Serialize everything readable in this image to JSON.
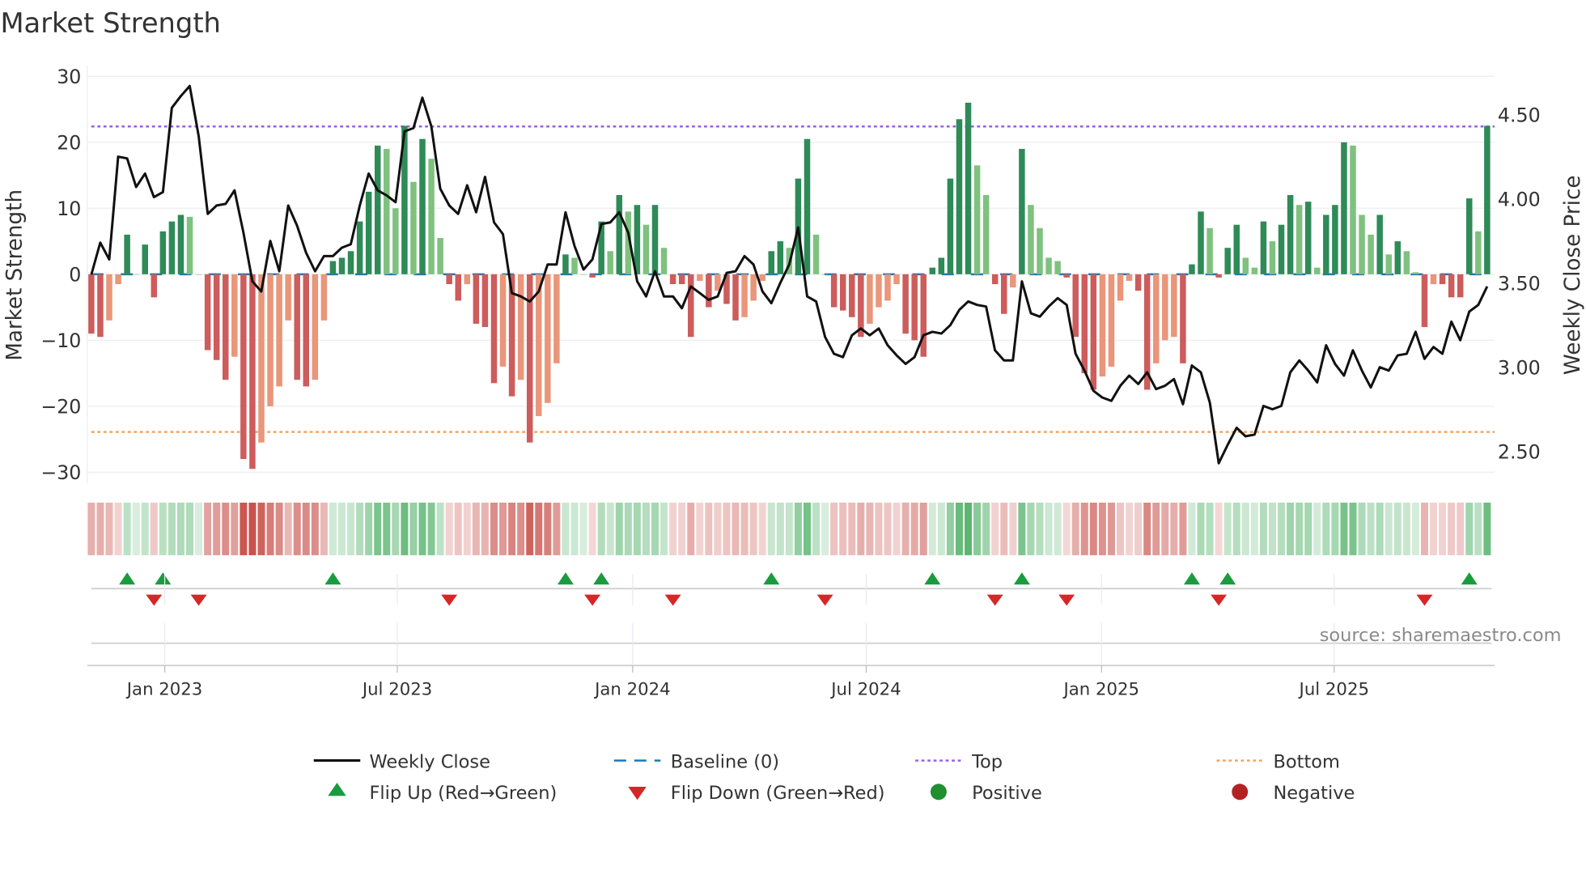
{
  "chart_data": {
    "type": "bar",
    "title": "Market Strength",
    "ylabel": "Market Strength",
    "y2label": "Weekly Close Price",
    "ylim": [
      -31.7,
      31.6
    ],
    "y2lim": [
      2.31,
      4.79
    ],
    "yticks": [
      30,
      20,
      10,
      0,
      -10,
      -20,
      -30
    ],
    "ytick_labels": [
      "30",
      "20",
      "10",
      "0",
      "−10",
      "−20",
      "−30"
    ],
    "y2ticks": [
      4.5,
      4.0,
      3.5,
      3.0,
      2.5
    ],
    "y2tick_labels": [
      "4.50",
      "4.00",
      "3.50",
      "3.00",
      "2.50"
    ],
    "xticks": [
      {
        "week": 8.2,
        "label": "Jan 2023"
      },
      {
        "week": 34.2,
        "label": "Jul 2023"
      },
      {
        "week": 60.5,
        "label": "Jan 2024"
      },
      {
        "week": 86.6,
        "label": "Jul 2024"
      },
      {
        "week": 112.9,
        "label": "Jan 2025"
      },
      {
        "week": 138.9,
        "label": "Jul 2025"
      }
    ],
    "top_level": 22.4,
    "bottom_level": -23.9,
    "strength": [
      -9,
      -9.5,
      -7,
      -1.5,
      6,
      0,
      4.5,
      -3.5,
      6.5,
      8,
      9,
      8.7,
      0,
      -11.5,
      -13,
      -16,
      -12.5,
      -28,
      -29.5,
      -25.5,
      -20,
      -17,
      -7,
      -16,
      -17,
      -16,
      -7,
      2,
      2.5,
      3.5,
      8,
      12.5,
      19.5,
      19,
      10,
      22.5,
      14,
      20.5,
      17.5,
      5.5,
      -1.5,
      -4,
      -1.5,
      -7.5,
      -8,
      -16.5,
      -14,
      -18.5,
      -16,
      -25.5,
      -21.5,
      -19.5,
      -13.5,
      3,
      2.5,
      0,
      -0.5,
      8,
      3.5,
      12,
      9.5,
      10.5,
      7.5,
      10.5,
      4,
      -1.5,
      -1.5,
      -9.5,
      -1,
      -5,
      -2.5,
      -4.5,
      -7,
      -6.5,
      -4,
      -1,
      3.5,
      5,
      4,
      14.5,
      20.5,
      6,
      0,
      -5,
      -5.5,
      -6.5,
      -9.5,
      -7.5,
      -5,
      -4,
      -1.5,
      -9,
      -10,
      -12.5,
      1,
      2.5,
      14.5,
      23.5,
      26,
      16.5,
      12,
      -1.5,
      -6,
      -2,
      19,
      10.5,
      7,
      2.5,
      2,
      -0.5,
      -9.5,
      -15,
      -17.5,
      -15.5,
      -14,
      -4,
      -1,
      -2.5,
      -17.5,
      -13.5,
      -10,
      -9.5,
      -13.5,
      1.5,
      9.5,
      7,
      -0.5,
      4,
      7.5,
      2.5,
      1,
      8,
      5,
      7.5,
      12,
      10.5,
      11,
      1,
      9,
      10.5,
      20,
      19.5,
      9,
      6,
      9,
      3,
      5,
      3.5,
      0.3,
      -8,
      -1.5,
      -1.5,
      -3.5,
      -3.5,
      11.5,
      6.5,
      22.5
    ],
    "weekly_close": [
      3.55,
      3.74,
      3.64,
      4.25,
      4.24,
      4.07,
      4.15,
      4.01,
      4.04,
      4.54,
      4.61,
      4.67,
      4.37,
      3.91,
      3.96,
      3.97,
      4.05,
      3.8,
      3.51,
      3.45,
      3.75,
      3.57,
      3.96,
      3.84,
      3.68,
      3.57,
      3.66,
      3.66,
      3.71,
      3.73,
      3.96,
      4.15,
      4.05,
      4.02,
      3.98,
      4.4,
      4.42,
      4.6,
      4.43,
      4.06,
      3.96,
      3.91,
      4.08,
      3.92,
      4.13,
      3.86,
      3.79,
      3.44,
      3.42,
      3.39,
      3.45,
      3.61,
      3.61,
      3.92,
      3.72,
      3.58,
      3.64,
      3.85,
      3.86,
      3.92,
      3.8,
      3.51,
      3.42,
      3.57,
      3.42,
      3.42,
      3.35,
      3.48,
      3.44,
      3.4,
      3.42,
      3.56,
      3.57,
      3.66,
      3.61,
      3.45,
      3.38,
      3.5,
      3.61,
      3.83,
      3.42,
      3.39,
      3.18,
      3.08,
      3.06,
      3.19,
      3.23,
      3.19,
      3.23,
      3.13,
      3.07,
      3.02,
      3.06,
      3.19,
      3.21,
      3.2,
      3.25,
      3.34,
      3.39,
      3.37,
      3.36,
      3.1,
      3.04,
      3.04,
      3.51,
      3.32,
      3.3,
      3.36,
      3.41,
      3.37,
      3.08,
      2.98,
      2.86,
      2.82,
      2.8,
      2.89,
      2.95,
      2.9,
      2.97,
      2.87,
      2.89,
      2.93,
      2.78,
      3.01,
      2.97,
      2.79,
      2.43,
      2.54,
      2.64,
      2.59,
      2.6,
      2.77,
      2.75,
      2.77,
      2.97,
      3.04,
      2.98,
      2.91,
      3.13,
      3.02,
      2.95,
      3.1,
      2.98,
      2.88,
      3.0,
      2.98,
      3.07,
      3.08,
      3.21,
      3.05,
      3.12,
      3.08,
      3.27,
      3.16,
      3.33,
      3.37,
      3.48
    ],
    "flip_up_weeks": [
      4,
      8,
      27,
      53,
      57,
      76,
      94,
      104,
      123,
      127,
      154
    ],
    "flip_down_weeks": [
      7,
      12,
      40,
      56,
      65,
      82,
      101,
      109,
      126,
      149
    ],
    "legend": {
      "weekly_close": "Weekly Close",
      "baseline": "Baseline (0)",
      "top": "Top",
      "bottom": "Bottom",
      "flip_up": "Flip Up (Red→Green)",
      "flip_down": "Flip Down (Green→Red)",
      "positive": "Positive",
      "negative": "Negative"
    },
    "legend_placement": "bottom",
    "grid": true
  },
  "source": "source: sharemaestro.com",
  "colors": {
    "pos_strong": "#2e8b57",
    "pos_weak": "#7fc17f",
    "neg_strong": "#cd5c5c",
    "neg_weak": "#e9967a",
    "baseline": "#1f77b4",
    "top": "#9b5de5",
    "bottom": "#f4a460",
    "line": "#111111",
    "flip_up": "#1a9c3e",
    "flip_down": "#d62728",
    "positive": "#1f8f2f",
    "negative": "#b22222"
  }
}
